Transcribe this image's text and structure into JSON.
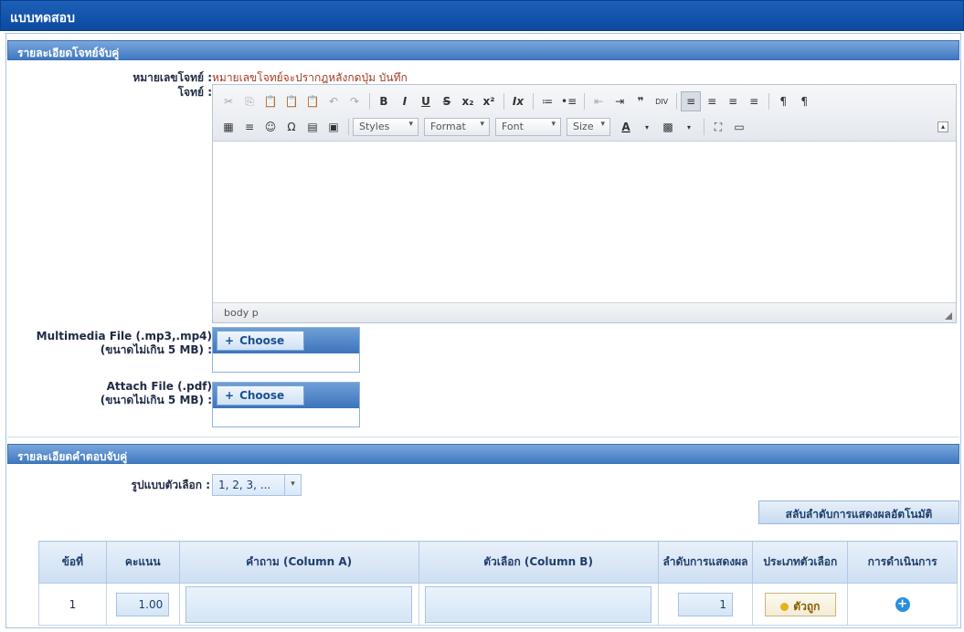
{
  "window": {
    "title": "แบบทดสอบ"
  },
  "sections": {
    "question": {
      "title": "รายละเอียดโจทย์จับคู่"
    },
    "answer": {
      "title": "รายละเอียดคำตอบจับคู่"
    }
  },
  "question_form": {
    "number_label": "หมายเลขโจทย์ :",
    "number_value": "หมายเลขโจทย์จะปรากฎหลังกดปุ่ม บันทึก",
    "question_label": "โจทย์ :",
    "editor": {
      "row1": [
        "✂",
        "⎘",
        "📋",
        "📋",
        "📋",
        "↶",
        "↷",
        "B",
        "I",
        "U",
        "S",
        "x₂",
        "x²",
        "Ix",
        "≔",
        "•≡",
        "⇤",
        "⇥",
        "❞",
        "DIV",
        "≡",
        "≡",
        "≡",
        "≡",
        "¶",
        "¶"
      ],
      "row2": [
        "▦",
        "≡",
        "☺",
        "Ω",
        "▤",
        "▣"
      ],
      "combos": [
        "Styles",
        "Format",
        "Font",
        "Size"
      ],
      "color_buttons": [
        "A",
        "▩"
      ],
      "extra_buttons": [
        "⛶",
        "▭"
      ],
      "footer_path": "body  p"
    },
    "multimedia": {
      "label_line1": "Multimedia File (.mp3,.mp4)",
      "label_line2": "(ขนาดไม่เกิน 5 MB) :",
      "button": "Choose"
    },
    "attach": {
      "label_line1": "Attach File (.pdf)",
      "label_line2": "(ขนาดไม่เกิน 5 MB) :",
      "button": "Choose"
    }
  },
  "answer_form": {
    "format_label": "รูปแบบตัวเลือก :",
    "format_value": "1, 2, 3, ...",
    "shuffle_button": "สลับลำดับการแสดงผลอัตโนมัติ",
    "table": {
      "headers": [
        "ข้อที่",
        "คะแนน",
        "คำถาม (Column A)",
        "ตัวเลือก (Column B)",
        "ลำดับการแสดงผล",
        "ประเภทตัวเลือก",
        "การดำเนินการ"
      ],
      "rows": [
        {
          "no": "1",
          "score": "1.00",
          "question": "",
          "choice": "",
          "order": "1",
          "type": "ตัวถูก",
          "action": "+"
        }
      ]
    }
  },
  "colors": {
    "title_bar": "#0d4aa0",
    "section_header": "#3f79c2",
    "accent_button": "#e8b21b",
    "add_icon": "#2a8ee0"
  }
}
